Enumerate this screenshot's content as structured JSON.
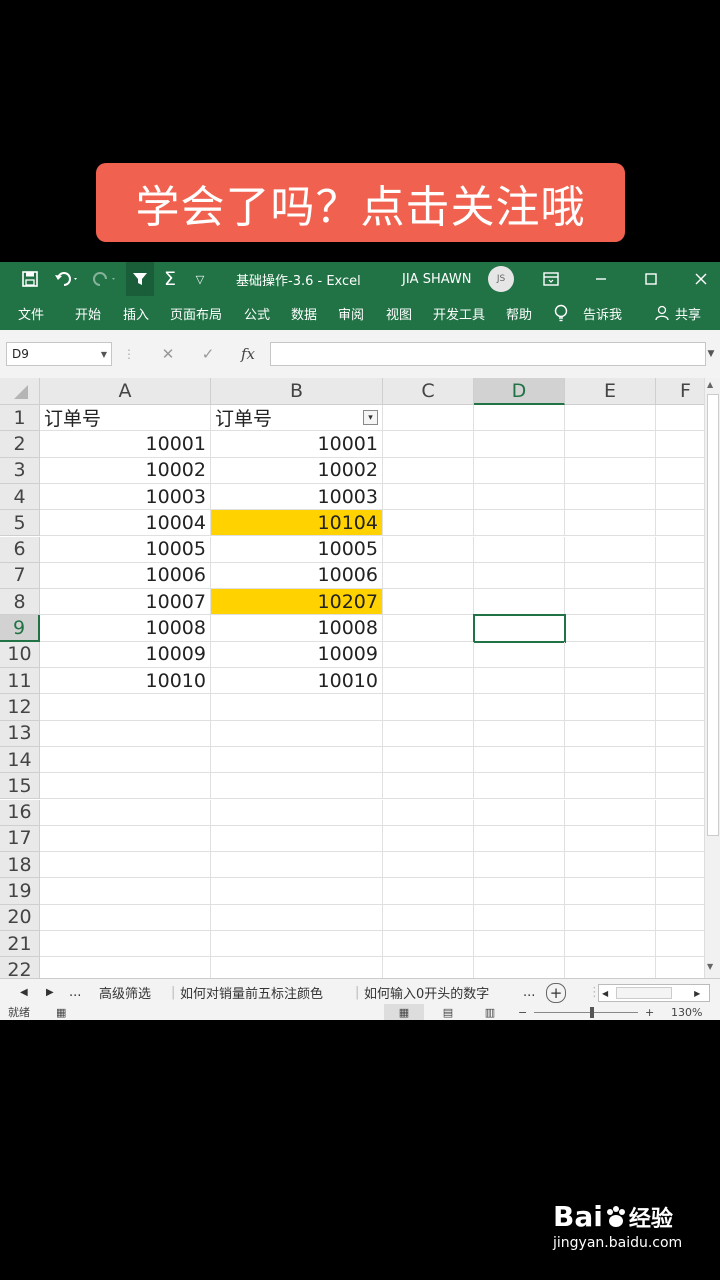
{
  "banner": {
    "text": "学会了吗？点击关注哦"
  },
  "titlebar": {
    "title": "基础操作-3.6  -  Excel",
    "user": "JIA SHAWN",
    "avatar": "JS",
    "icons": [
      "save-icon",
      "undo-icon",
      "redo-icon",
      "filter-icon",
      "sum-icon",
      "customize-icon",
      "ribbon-display-icon",
      "minimize-icon",
      "maximize-icon",
      "close-icon"
    ]
  },
  "ribbon": {
    "tabs": [
      "文件",
      "开始",
      "插入",
      "页面布局",
      "公式",
      "数据",
      "审阅",
      "视图",
      "开发工具",
      "帮助"
    ],
    "tellme": "告诉我",
    "share": "共享"
  },
  "formulabar": {
    "namebox": "D9",
    "cancel": "✕",
    "enter": "✓",
    "fx": "fx",
    "value": ""
  },
  "grid": {
    "columns": [
      "A",
      "B",
      "C",
      "D",
      "E",
      "F"
    ],
    "selected_cell": "D9",
    "rows": [
      {
        "n": "1",
        "a": "订单号",
        "b": "订单号"
      },
      {
        "n": "2",
        "a": "10001",
        "b": "10001"
      },
      {
        "n": "3",
        "a": "10002",
        "b": "10002"
      },
      {
        "n": "4",
        "a": "10003",
        "b": "10003"
      },
      {
        "n": "5",
        "a": "10004",
        "b": "10104"
      },
      {
        "n": "6",
        "a": "10005",
        "b": "10005"
      },
      {
        "n": "7",
        "a": "10006",
        "b": "10006"
      },
      {
        "n": "8",
        "a": "10007",
        "b": "10207"
      },
      {
        "n": "9",
        "a": "10008",
        "b": "10008"
      },
      {
        "n": "10",
        "a": "10009",
        "b": "10009"
      },
      {
        "n": "11",
        "a": "10010",
        "b": "10010"
      },
      {
        "n": "12",
        "a": "",
        "b": ""
      },
      {
        "n": "13",
        "a": "",
        "b": ""
      },
      {
        "n": "14",
        "a": "",
        "b": ""
      },
      {
        "n": "15",
        "a": "",
        "b": ""
      },
      {
        "n": "16",
        "a": "",
        "b": ""
      },
      {
        "n": "17",
        "a": "",
        "b": ""
      },
      {
        "n": "18",
        "a": "",
        "b": ""
      },
      {
        "n": "19",
        "a": "",
        "b": ""
      },
      {
        "n": "20",
        "a": "",
        "b": ""
      },
      {
        "n": "21",
        "a": "",
        "b": ""
      },
      {
        "n": "22",
        "a": "",
        "b": ""
      }
    ],
    "highlighted_b_rows": [
      "5",
      "8"
    ],
    "highlight_color": "#ffd200"
  },
  "sheets": {
    "ellipsis": "...",
    "tabs": [
      "高级筛选",
      "如何对销量前五标注颜色",
      "如何输入0开头的数字"
    ],
    "more": "...",
    "add": "+"
  },
  "status": {
    "mode": "就绪",
    "zoom": "130%"
  },
  "watermark": {
    "brand": "Bai",
    "brand2": "经验",
    "url": "jingyan.baidu.com"
  },
  "colors": {
    "excel_green": "#217346",
    "banner": "#f0624f"
  }
}
